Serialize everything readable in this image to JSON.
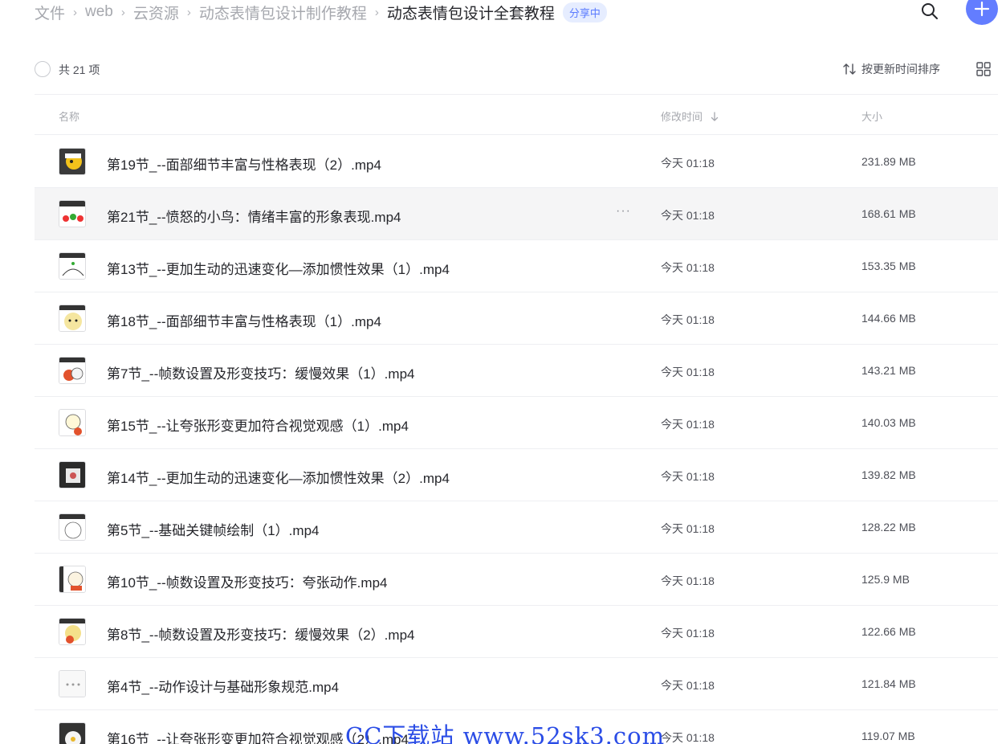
{
  "breadcrumb": {
    "items": [
      "文件",
      "web",
      "云资源",
      "动态表情包设计制作教程"
    ],
    "separator": "›",
    "current": "动态表情包设计全套教程",
    "badge": "分享中"
  },
  "toolbar": {
    "count_text": "共 21 项",
    "sort_label": "按更新时间排序"
  },
  "columns": {
    "name": "名称",
    "modified": "修改时间",
    "size": "大小"
  },
  "files": [
    {
      "name": "第19节_--面部细节丰富与性格表现（2）.mp4",
      "time": "今天 01:18",
      "size": "231.89 MB"
    },
    {
      "name": "第21节_--愤怒的小鸟：情绪丰富的形象表现.mp4",
      "time": "今天 01:18",
      "size": "168.61 MB"
    },
    {
      "name": "第13节_--更加生动的迅速变化—添加惯性效果（1）.mp4",
      "time": "今天 01:18",
      "size": "153.35 MB"
    },
    {
      "name": "第18节_--面部细节丰富与性格表现（1）.mp4",
      "time": "今天 01:18",
      "size": "144.66 MB"
    },
    {
      "name": "第7节_--帧数设置及形变技巧：缓慢效果（1）.mp4",
      "time": "今天 01:18",
      "size": "143.21 MB"
    },
    {
      "name": "第15节_--让夸张形变更加符合视觉观感（1）.mp4",
      "time": "今天 01:18",
      "size": "140.03 MB"
    },
    {
      "name": "第14节_--更加生动的迅速变化—添加惯性效果（2）.mp4",
      "time": "今天 01:18",
      "size": "139.82 MB"
    },
    {
      "name": "第5节_--基础关键帧绘制（1）.mp4",
      "time": "今天 01:18",
      "size": "128.22 MB"
    },
    {
      "name": "第10节_--帧数设置及形变技巧：夸张动作.mp4",
      "time": "今天 01:18",
      "size": "125.9 MB"
    },
    {
      "name": "第8节_--帧数设置及形变技巧：缓慢效果（2）.mp4",
      "time": "今天 01:18",
      "size": "122.66 MB"
    },
    {
      "name": "第4节_--动作设计与基础形象规范.mp4",
      "time": "今天 01:18",
      "size": "121.84 MB"
    },
    {
      "name": "第16节_--让夸张形变更加符合视觉观感（2）.mp4",
      "time": "今天 01:18",
      "size": "119.07 MB"
    }
  ],
  "row_more_label": "···",
  "watermark": "CC下载站 www.52sk3.com",
  "colors": {
    "accent": "#637dff",
    "badge_bg": "#e6edff",
    "badge_text": "#5a7bff",
    "hover_row": "#f5f5f6",
    "watermark": "#2b4de6"
  }
}
